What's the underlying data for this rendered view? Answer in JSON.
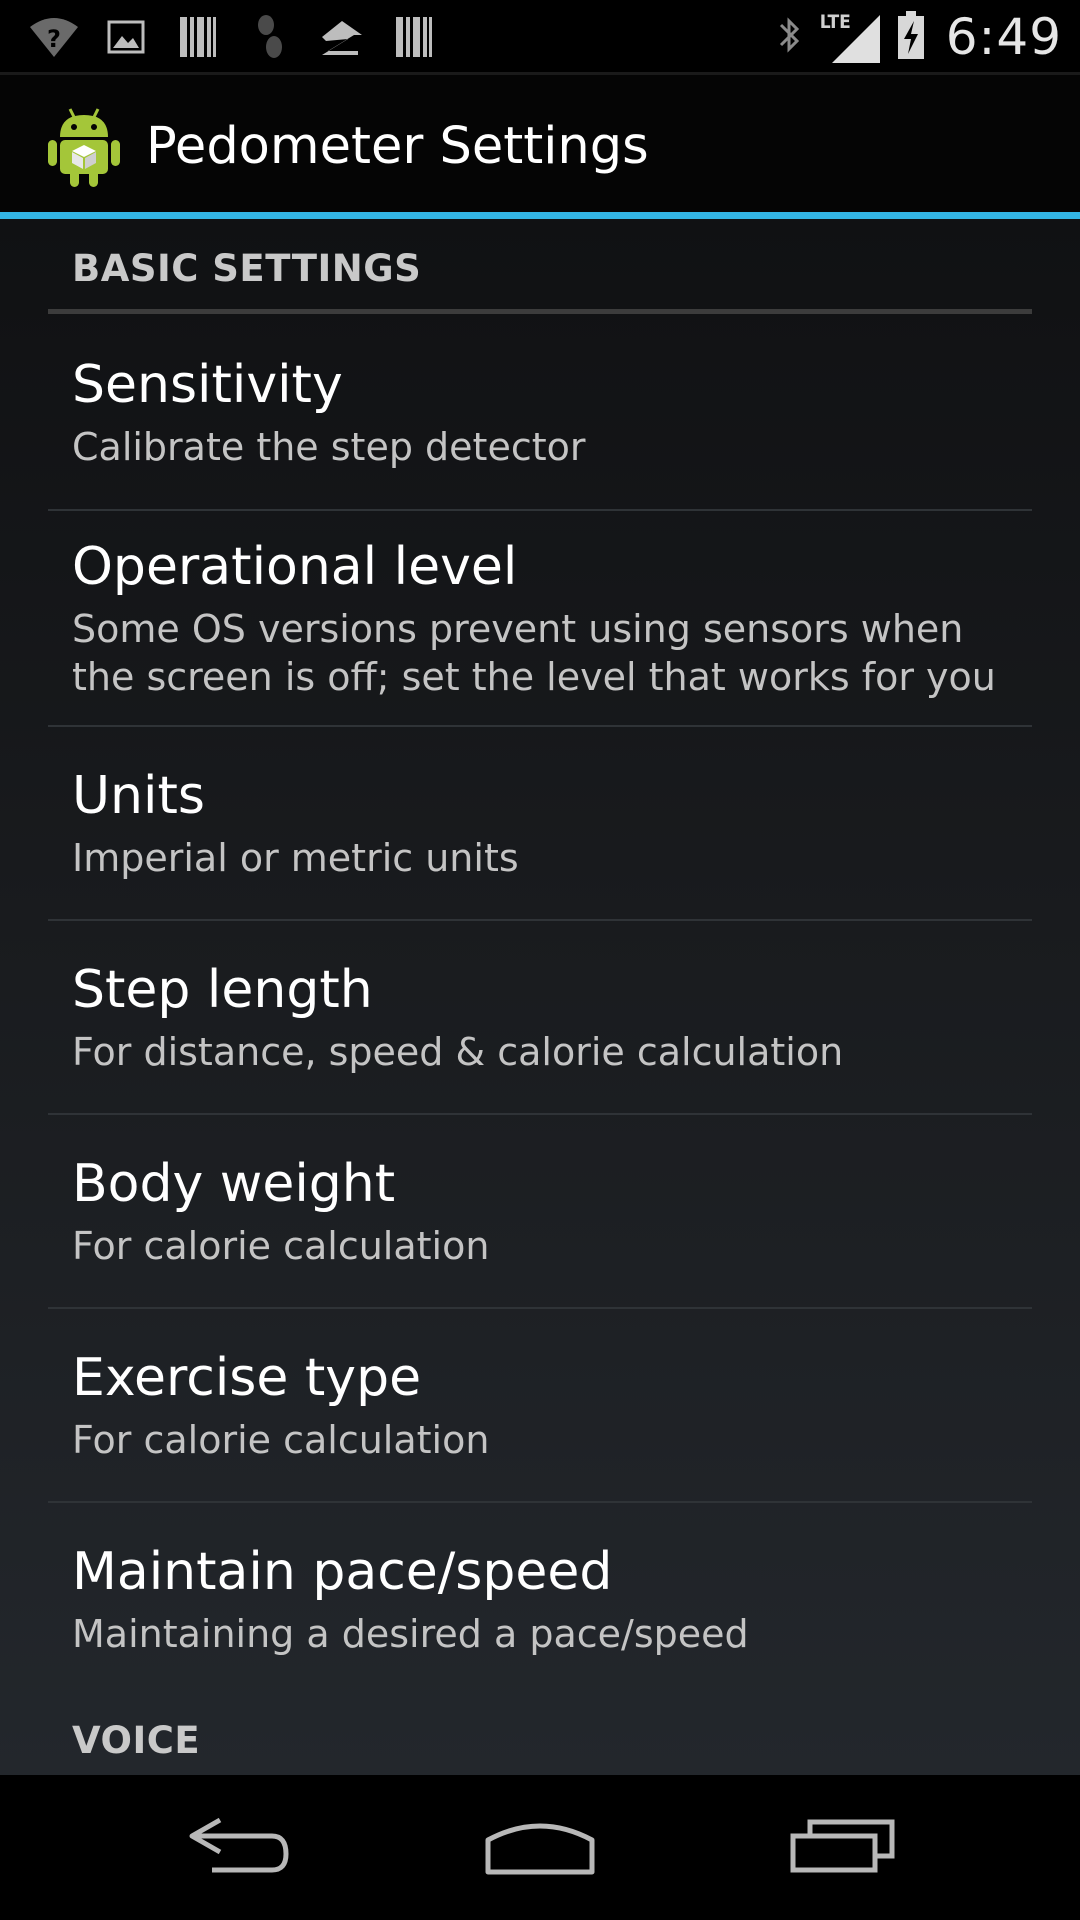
{
  "status_bar": {
    "time": "6:49",
    "network": "LTE",
    "left_icons": [
      "wifi-question-icon",
      "image-icon",
      "barcode-icon",
      "footprint-icon",
      "zillow-icon",
      "barcode-icon"
    ],
    "right_icons": [
      "bluetooth-icon",
      "signal-icon",
      "battery-charging-icon"
    ]
  },
  "action_bar": {
    "title": "Pedometer Settings",
    "logo": "android-icon"
  },
  "sections": {
    "basic": {
      "header": "BASIC SETTINGS"
    },
    "voice": {
      "header": "VOICE"
    }
  },
  "prefs": [
    {
      "title": "Sensitivity",
      "summary": "Calibrate the step detector"
    },
    {
      "title": "Operational level",
      "summary_lines": [
        "Some OS versions prevent using sensors when",
        "the screen is off; set the level that works for you"
      ]
    },
    {
      "title": "Units",
      "summary": "Imperial or metric units"
    },
    {
      "title": "Step length",
      "summary": "For distance, speed & calorie calculation"
    },
    {
      "title": "Body weight",
      "summary": "For calorie calculation"
    },
    {
      "title": "Exercise type",
      "summary": "For calorie calculation"
    },
    {
      "title": "Maintain pace/speed",
      "summary": "Maintaining a desired a pace/speed"
    }
  ],
  "nav_bar": {
    "buttons": [
      "back-icon",
      "home-icon",
      "recent-apps-icon"
    ]
  },
  "colors": {
    "accent": "#33b5e5",
    "android_green": "#a4c639"
  }
}
